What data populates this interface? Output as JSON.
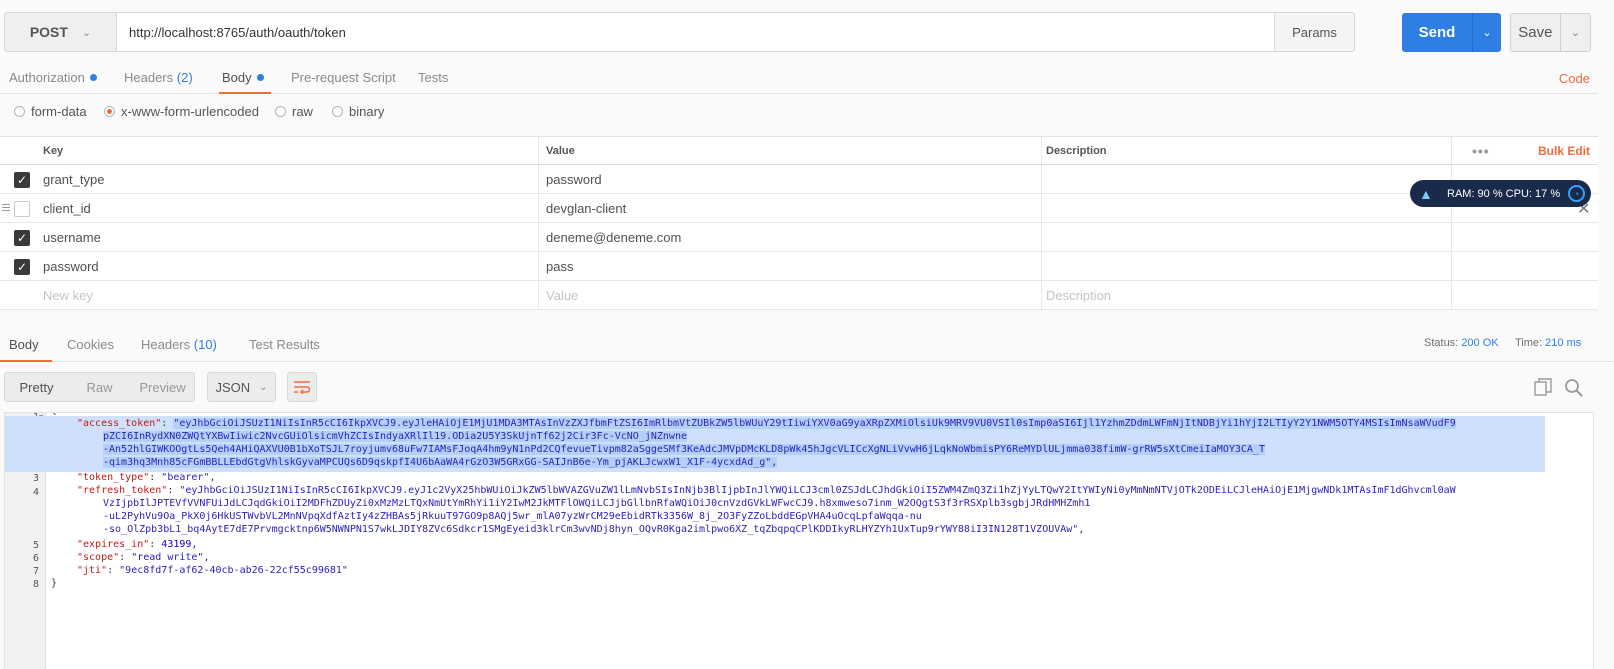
{
  "request": {
    "method": "POST",
    "url": "http://localhost:8765/auth/oauth/token",
    "params_label": "Params",
    "send_label": "Send",
    "save_label": "Save"
  },
  "request_tabs": {
    "authorization": "Authorization",
    "headers": "Headers",
    "headers_count": "(2)",
    "body": "Body",
    "prerequest": "Pre-request Script",
    "tests": "Tests",
    "code": "Code"
  },
  "body_types": {
    "form_data": "form-data",
    "urlencoded": "x-www-form-urlencoded",
    "raw": "raw",
    "binary": "binary",
    "selected": "x-www-form-urlencoded"
  },
  "kv_table": {
    "headers": {
      "key": "Key",
      "value": "Value",
      "description": "Description",
      "more": "•••",
      "bulk_edit": "Bulk Edit"
    },
    "rows": [
      {
        "checked": true,
        "key": "grant_type",
        "value": "password"
      },
      {
        "checked": false,
        "key": "client_id",
        "value": "devglan-client"
      },
      {
        "checked": true,
        "key": "username",
        "value": "deneme@deneme.com"
      },
      {
        "checked": true,
        "key": "password",
        "value": "pass"
      }
    ],
    "placeholder": {
      "key": "New key",
      "value": "Value",
      "description": "Description"
    }
  },
  "perf": {
    "text": "RAM: 90 %  CPU: 17 %"
  },
  "response_tabs": {
    "body": "Body",
    "cookies": "Cookies",
    "headers": "Headers",
    "headers_count": "(10)",
    "test_results": "Test Results",
    "status_label": "Status:",
    "status_value": "200 OK",
    "time_label": "Time:",
    "time_value": "210 ms"
  },
  "response_toolbar": {
    "pretty": "Pretty",
    "raw": "Raw",
    "preview": "Preview",
    "format": "JSON"
  },
  "response_body": {
    "line_numbers": [
      "1",
      "2",
      "3",
      "4",
      "5",
      "6",
      "7",
      "8"
    ],
    "open_brace": "{",
    "close_brace": "}",
    "access_token_key": "\"access_token\"",
    "access_token_lines": [
      "\"eyJhbGciOiJSUzI1NiIsInR5cCI6IkpXVCJ9.eyJleHAiOjE1MjU1MDA3MTAsInVzZXJfbmFtZSI6ImRlbmVtZUBkZW5lbWUuY29tIiwiYXV0aG9yaXRpZXMiOlsiUk9MRV9VU0VSIl0sImp0aSI6Ijl1YzhmZDdmLWFmNjItNDBjYi1hYjI2LTIyY2Y1NWM5OTY4MSIsImNsaWVudF9",
      "pZCI6InRydXN0ZWQtYXBwIiwic2NvcGUiOlsicmVhZCIsIndyaXRlIl19.ODia2U5Y3SkUjnTf62j2Cir3Fc-VcNO_jNZnwne",
      "-An52hlGIWKOOgtLs5Qeh4AHiQAXVU0B1bXoTSJL7royjumv68uFw7IAMsFJoqA4hm9yN1nPd2CQfevueTivpm82aSggeSMf3KeAdcJMVpDMcKLD8pWk45hJgcVLICcXgNLiVvwH6jLqkNoWbmisPY6ReMYDlULjmma038fimW-grRW5sXtCmeiIaMOY3CA_T",
      "-qim3hq3Mnh85cFGmBBLLEbdGtgVhlskGyvaMPCUQs6D9qskpfI4U6bAaWA4rGzO3W5GRxGG-SAIJnB6e-Ym_pjAKLJcwxW1_X1F-4ycxdAd_g\","
    ],
    "token_type_key": "\"token_type\"",
    "token_type_value": "\"bearer\",",
    "refresh_token_key": "\"refresh_token\"",
    "refresh_token_lines": [
      "\"eyJhbGciOiJSUzI1NiIsInR5cCI6IkpXVCJ9.eyJ1c2VyX25hbWUiOiJkZW5lbWVAZGVuZW1lLmNvbSIsInNjb3BlIjpbInJlYWQiLCJ3cml0ZSJdLCJhdGkiOiI5ZWM4ZmQ3Zi1hZjYyLTQwY2ItYWIyNi0yMmNmNTVjOTk2ODEiLCJleHAiOjE1MjgwNDk1MTAsImF1dGhvcml0aW",
      "VzIjpbIlJPTEVfVVNFUiJdLCJqdGkiOiI2MDFhZDUyZi0xMzMzLTQxNmUtYmRhYi1iY2IwM2JkMTFlOWQiLCJjbGllbnRfaWQiOiJ0cnVzdGVkLWFwcCJ9.h8xmweso7inm_W2OQgtS3f3rRSXplb3sgbjJRdHMHZmh1",
      "-uL2PyhVu9Oa_PkX0j6HkUSTWvbVL2MnNVpqXdfAztIy4zZHBAs5jRkuuT97GO9p8AQj5wr_mlA07yzWrCM29eEbidRTk3356W_8j_2O3FyZZoLbddEGpVHA4uOcqLpfaWqqa-nu",
      "-so_OlZpb3bL1_bq4AytE7dE7Prvmgcktnp6W5NWNPN1S7wkLJDIY8ZVc6Sdkcr1SMgEyeid3klrCm3wvNDj8hyn_OQvR0Kga2imlpwo6XZ_tqZbqpqCPlKDDIkyRLHYZYh1UxTup9rYWY88iI3IN128T1VZOUVAw\","
    ],
    "expires_in_key": "\"expires_in\"",
    "expires_in_value": "43199,",
    "scope_key": "\"scope\"",
    "scope_value": "\"read write\",",
    "jti_key": "\"jti\"",
    "jti_value": "\"9ec8fd7f-af62-40cb-ab26-22cf55c99681\""
  },
  "colors": {
    "accent": "#f26b3a",
    "primary": "#2e7ee3",
    "selection": "#cfe0fb"
  },
  "icons": [
    "chevron-down-icon",
    "dot-indicator-icon",
    "checkbox-icon",
    "drag-handle-icon",
    "close-icon",
    "rocket-icon",
    "gauge-icon",
    "wrap-lines-icon",
    "copy-icon",
    "search-icon",
    "fold-arrow-icon"
  ]
}
